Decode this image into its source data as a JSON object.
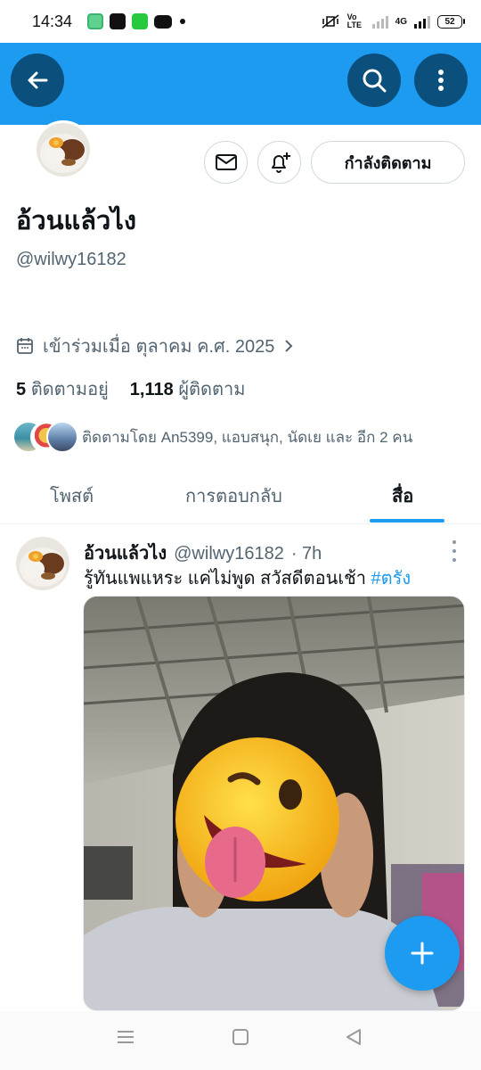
{
  "status_bar": {
    "time": "14:34",
    "network_label": "4G",
    "volte_label": "Vo LTE",
    "battery": "52",
    "app_icons": [
      "line-icon",
      "shopee-icon",
      "grab-icon",
      "youtube-icon"
    ]
  },
  "profile": {
    "display_name": "อ้วนแล้วไง",
    "handle": "@wilwy16182",
    "joined": "เข้าร่วมเมื่อ ตุลาคม ค.ศ. 2025",
    "following_count": "5",
    "following_label": "ติดตามอยู่",
    "followers_count": "1,118",
    "followers_label": "ผู้ติดตาม",
    "followed_by": "ติดตามโดย An5399, แอบสนุก, นัดเย และ อีก 2 คน",
    "follow_button_label": "กำลังติดตาม"
  },
  "tabs": [
    {
      "label": "โพสต์",
      "active": false
    },
    {
      "label": "การตอบกลับ",
      "active": false
    },
    {
      "label": "สื่อ",
      "active": true
    }
  ],
  "post": {
    "author_name": "อ้วนแล้วไง",
    "author_handle": "@wilwy16182",
    "time": "· 7h",
    "text": "รู้ทันแพแหระ แค่ไม่พูด สวัสดีตอนเช้า ",
    "hashtag": "#ตรัง"
  },
  "colors": {
    "accent": "#1d9bf0",
    "header_button": "#0b4f7c",
    "secondary_text": "#536471"
  }
}
